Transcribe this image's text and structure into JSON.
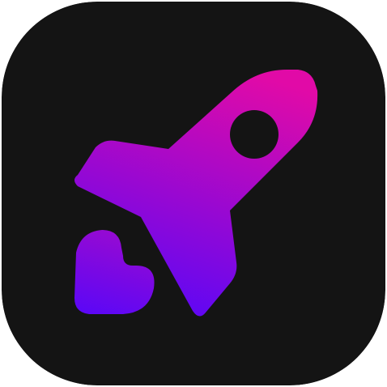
{
  "icon": {
    "name": "rocket-app-icon",
    "background_color": "#141414",
    "gradient_top_color": "#e10aa7",
    "gradient_bottom_color": "#5b07f6",
    "glyphs": [
      "rocket-icon",
      "heart-icon"
    ]
  }
}
